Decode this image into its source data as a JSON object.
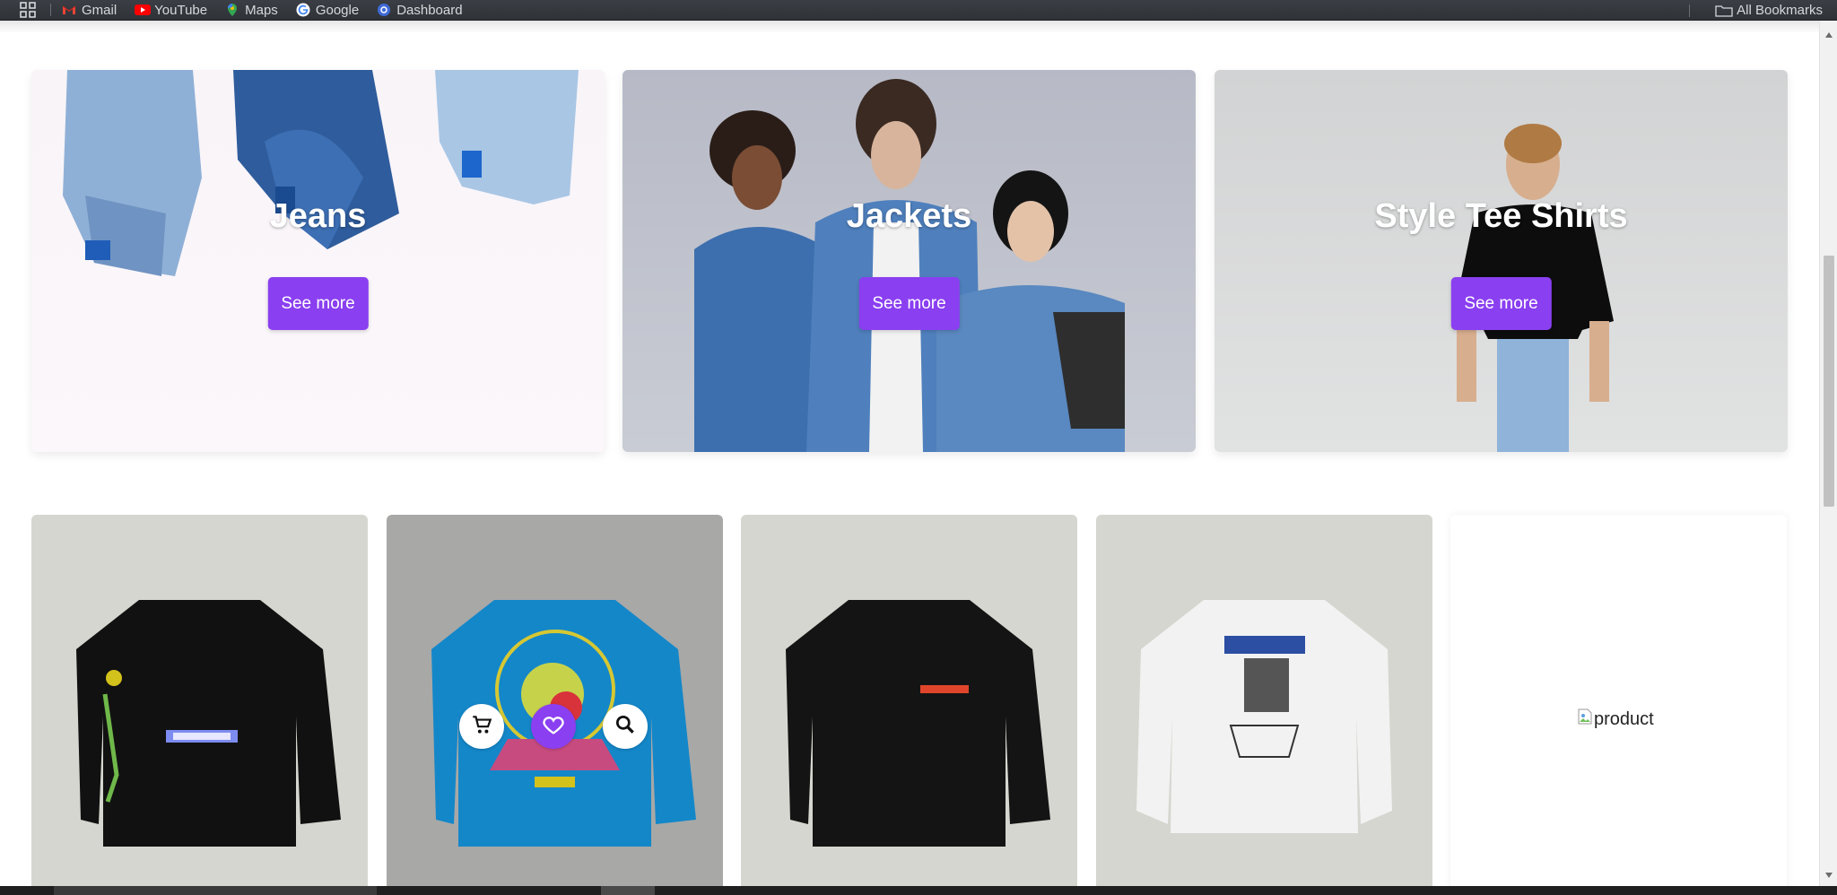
{
  "bookmarks_bar": {
    "items": [
      {
        "label": "Gmail",
        "icon": "gmail-icon"
      },
      {
        "label": "YouTube",
        "icon": "youtube-icon"
      },
      {
        "label": "Maps",
        "icon": "maps-icon"
      },
      {
        "label": "Google",
        "icon": "google-icon"
      },
      {
        "label": "Dashboard",
        "icon": "dashboard-icon"
      }
    ],
    "all_bookmarks_label": "All Bookmarks"
  },
  "categories": [
    {
      "title": "Jeans",
      "button_label": "See more"
    },
    {
      "title": "Jackets",
      "button_label": "See more"
    },
    {
      "title": "Style Tee Shirts",
      "button_label": "See more"
    }
  ],
  "products": [
    {
      "image": "black long sleeve tee"
    },
    {
      "image": "blue long sleeve tee"
    },
    {
      "image": "black long sleeve tee"
    },
    {
      "image": "white sweatshirt"
    },
    {
      "image_alt": "product"
    }
  ],
  "product_actions": {
    "cart": "cart-icon",
    "favorite": "heart-icon",
    "search": "search-icon"
  },
  "colors": {
    "accent": "#8a3ff0",
    "card_bg": "#d5d6cf"
  }
}
